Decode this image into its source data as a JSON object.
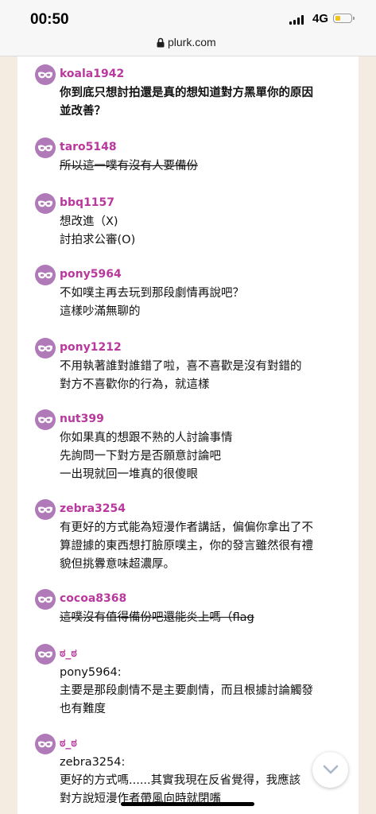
{
  "status_bar": {
    "time": "00:50",
    "network": "4G",
    "battery_level": 0.2,
    "battery_color": "#f0c21c"
  },
  "browser": {
    "url": "plurk.com"
  },
  "colors": {
    "username": "#b9389d",
    "avatar_icon": "#b07ab9",
    "page_background": "#f4ece1"
  },
  "responses": [
    {
      "username": "koala1942",
      "text": "你到底只想討拍還是真的想知道對方黑單你的原因\n並改善？",
      "style": "bold"
    },
    {
      "username": "taro5148",
      "text": "所以這一噗有沒有人要備份",
      "style": "strike"
    },
    {
      "username": "bbq1157",
      "text": "想改進（X)\n討拍求公審(O)",
      "style": "normal"
    },
    {
      "username": "pony5964",
      "text": "不如噗主再去玩到那段劇情再說吧？\n這樣吵滿無聊的",
      "style": "normal"
    },
    {
      "username": "pony1212",
      "text": "不用執著誰對誰錯了啦，喜不喜歡是沒有對錯的\n對方不喜歡你的行為，就這樣",
      "style": "normal"
    },
    {
      "username": "nut399",
      "text": "你如果真的想跟不熟的人討論事情\n先詢問一下對方是否願意討論吧\n一出現就回一堆真的很傻眼",
      "style": "normal"
    },
    {
      "username": "zebra3254",
      "text": "有更好的方式能為短漫作者講話，偏偏你拿出了不\n算證據的東西想打臉原噗主，你的發言雖然很有禮\n貌但挑釁意味超濃厚。",
      "style": "normal"
    },
    {
      "username": "cocoa8368",
      "text": "這噗沒有值得備份吧還能炎上嗎（flag",
      "style": "strike"
    },
    {
      "username": "ಠ_ಠ",
      "text": "pony5964:\n主要是那段劇情不是主要劇情，而且根據討論觸發\n也有難度",
      "style": "normal"
    },
    {
      "username": "ಠ_ಠ",
      "text": "zebra3254:\n更好的方式嗎......其實我現在反省覺得，我應該\n對方說短漫作者帶風向時就閉嘴",
      "style": "normal"
    }
  ],
  "icons": {
    "avatar": "anonymous-mask-icon",
    "scroll": "chevron-down-icon",
    "lock": "lock-icon"
  }
}
